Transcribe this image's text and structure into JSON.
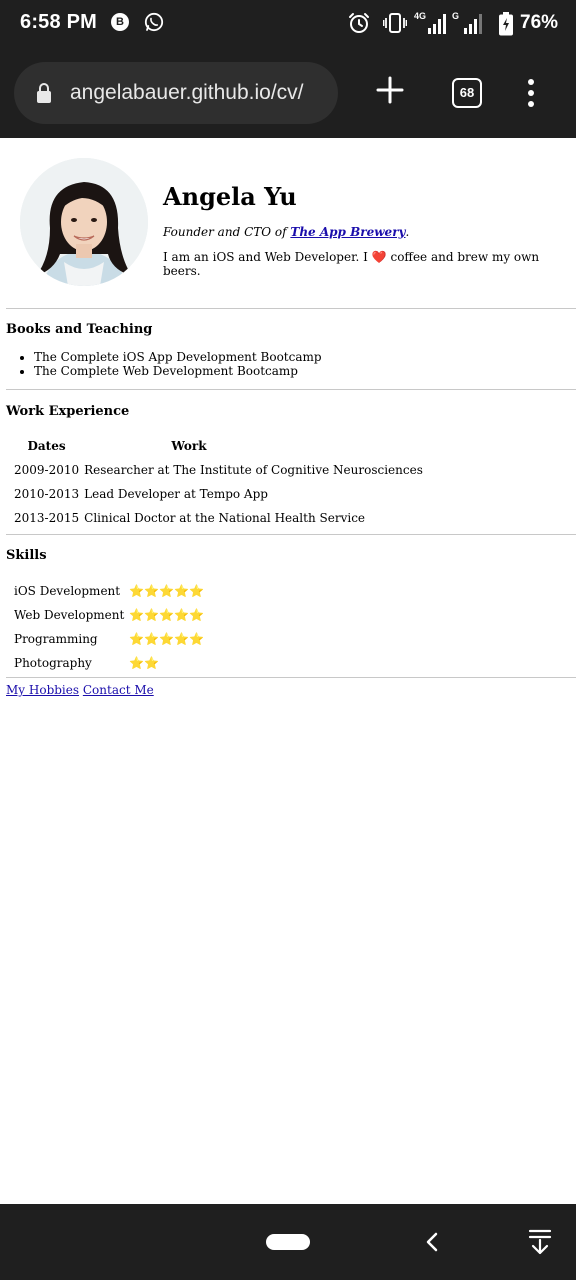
{
  "status_bar": {
    "time": "6:58 PM",
    "battery": "76%",
    "network_label": "4G",
    "network_label2": "G",
    "notification_icons": [
      "b-app-icon",
      "whatsapp-icon"
    ],
    "system_icons": [
      "alarm-icon",
      "vibrate-icon",
      "signal-icon",
      "battery-icon"
    ]
  },
  "browser": {
    "url": "angelabauer.github.io/cv/",
    "tab_count": "68"
  },
  "profile": {
    "name": "Angela Yu",
    "role_prefix": "Founder and CTO of ",
    "company_link": "The App Brewery",
    "role_suffix": ".",
    "bio_prefix": "I am an iOS and Web Developer. I ",
    "bio_heart": "❤️",
    "bio_suffix": " coffee and brew my own beers."
  },
  "books": {
    "title": "Books and Teaching",
    "items": [
      "The Complete iOS App Development Bootcamp",
      "The Complete Web Development Bootcamp"
    ]
  },
  "work": {
    "title": "Work Experience",
    "headers": [
      "Dates",
      "Work"
    ],
    "rows": [
      {
        "dates": "2009-2010",
        "work": "Researcher at The Institute of Cognitive Neurosciences"
      },
      {
        "dates": "2010-2013",
        "work": "Lead Developer at Tempo App"
      },
      {
        "dates": "2013-2015",
        "work": "Clinical Doctor at the National Health Service"
      }
    ]
  },
  "skills": {
    "title": "Skills",
    "rows": [
      {
        "name": "iOS Development",
        "stars": "⭐⭐⭐⭐⭐"
      },
      {
        "name": "Web Development",
        "stars": "⭐⭐⭐⭐⭐"
      },
      {
        "name": "Programming",
        "stars": "⭐⭐⭐⭐⭐"
      },
      {
        "name": "Photography",
        "stars": "⭐⭐"
      }
    ]
  },
  "footer_links": {
    "hobbies": "My Hobbies",
    "contact": "Contact Me"
  },
  "colors": {
    "system_bar": "#1f1f1f",
    "url_bar": "#2f2f2f",
    "link": "#1a0dab",
    "star": "#f5c518",
    "heart": "#e53935"
  }
}
